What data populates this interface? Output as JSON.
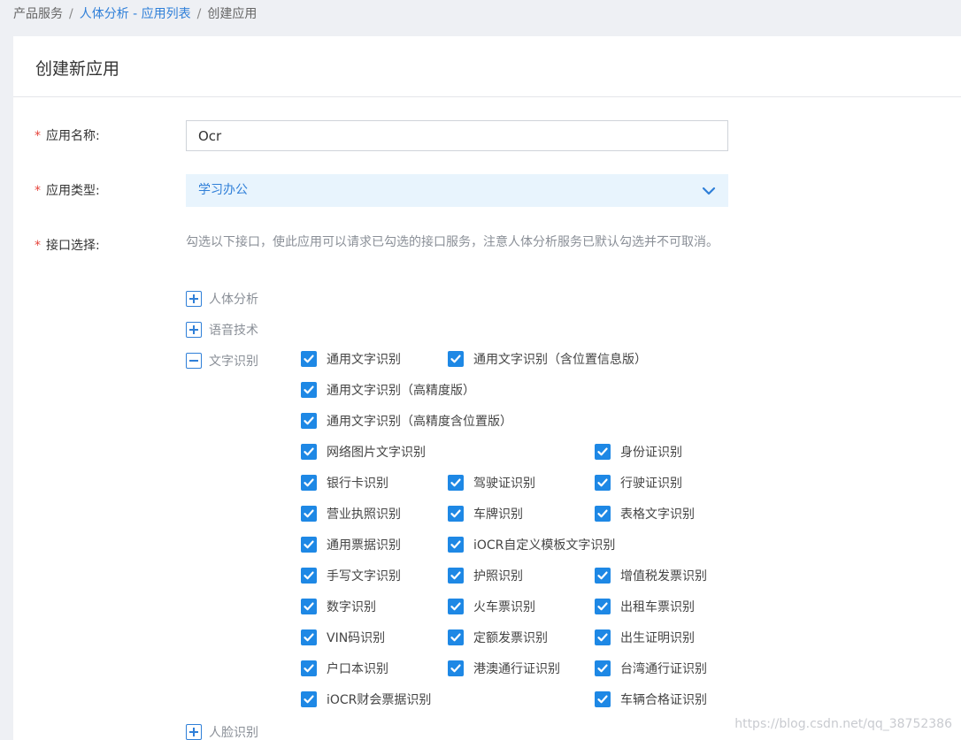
{
  "breadcrumb": {
    "items": [
      "产品服务",
      "人体分析 - 应用列表",
      "创建应用"
    ],
    "separator": "/"
  },
  "page": {
    "title": "创建新应用"
  },
  "form": {
    "required_mark": "*",
    "name_label": "应用名称:",
    "name_value": "Ocr",
    "type_label": "应用类型:",
    "type_value": "学习办公",
    "api_label": "接口选择:",
    "api_hint": "勾选以下接口，使此应用可以请求已勾选的接口服务，注意人体分析服务已默认勾选并不可取消。"
  },
  "groups": [
    {
      "label": "人体分析",
      "expanded": false
    },
    {
      "label": "语音技术",
      "expanded": false
    },
    {
      "label": "文字识别",
      "expanded": true
    },
    {
      "label": "人脸识别",
      "expanded": false
    }
  ],
  "ocr_items": [
    {
      "label": "通用文字识别",
      "checked": true
    },
    {
      "label": "通用文字识别（含位置信息版）",
      "checked": true
    },
    {
      "label": "通用文字识别（高精度版）",
      "checked": true
    },
    {
      "label": "通用文字识别（高精度含位置版）",
      "checked": true
    },
    {
      "label": "网络图片文字识别",
      "checked": true
    },
    {
      "label": "身份证识别",
      "checked": true
    },
    {
      "label": "银行卡识别",
      "checked": true
    },
    {
      "label": "驾驶证识别",
      "checked": true
    },
    {
      "label": "行驶证识别",
      "checked": true
    },
    {
      "label": "营业执照识别",
      "checked": true
    },
    {
      "label": "车牌识别",
      "checked": true
    },
    {
      "label": "表格文字识别",
      "checked": true
    },
    {
      "label": "通用票据识别",
      "checked": true
    },
    {
      "label": "iOCR自定义模板文字识别",
      "checked": true
    },
    {
      "label": "手写文字识别",
      "checked": true
    },
    {
      "label": "护照识别",
      "checked": true
    },
    {
      "label": "增值税发票识别",
      "checked": true
    },
    {
      "label": "数字识别",
      "checked": true
    },
    {
      "label": "火车票识别",
      "checked": true
    },
    {
      "label": "出租车票识别",
      "checked": true
    },
    {
      "label": "VIN码识别",
      "checked": true
    },
    {
      "label": "定额发票识别",
      "checked": true
    },
    {
      "label": "出生证明识别",
      "checked": true
    },
    {
      "label": "户口本识别",
      "checked": true
    },
    {
      "label": "港澳通行证识别",
      "checked": true
    },
    {
      "label": "台湾通行证识别",
      "checked": true
    },
    {
      "label": "iOCR财会票据识别",
      "checked": true
    },
    {
      "label": "车辆合格证识别",
      "checked": true
    }
  ],
  "watermark": "https://blog.csdn.net/qq_38752386",
  "colors": {
    "accent": "#2f7fd8",
    "checkbox": "#1e88e5",
    "required": "#e6453c",
    "select_bg": "#e8f4fd"
  }
}
